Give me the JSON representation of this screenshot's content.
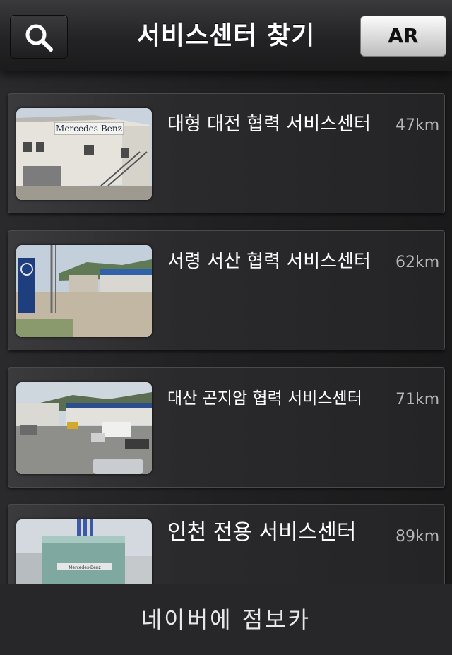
{
  "header": {
    "title": "서비스센터 찾기",
    "search_icon": "search-icon",
    "ar_label": "AR"
  },
  "centers": [
    {
      "name": "대형 대전 협력 서비스센터",
      "distance": "47km"
    },
    {
      "name": "서령 서산 협력 서비스센터",
      "distance": "62km"
    },
    {
      "name": "대산 곤지암 협력 서비스센터",
      "distance": "71km"
    },
    {
      "name": "인천 전용 서비스센터",
      "distance": "89km"
    }
  ],
  "thumbnails": {
    "0": {
      "sign": "Mercedes-Benz"
    },
    "3": {
      "sign": "Mercedes-Benz"
    }
  },
  "footer": {
    "link_label": "네이버에 점보카"
  },
  "colors": {
    "background": "#1c1c1d",
    "card": "#2a2a2c",
    "distance_text": "#b5b5b7",
    "ar_button": "#e2e2e2"
  }
}
